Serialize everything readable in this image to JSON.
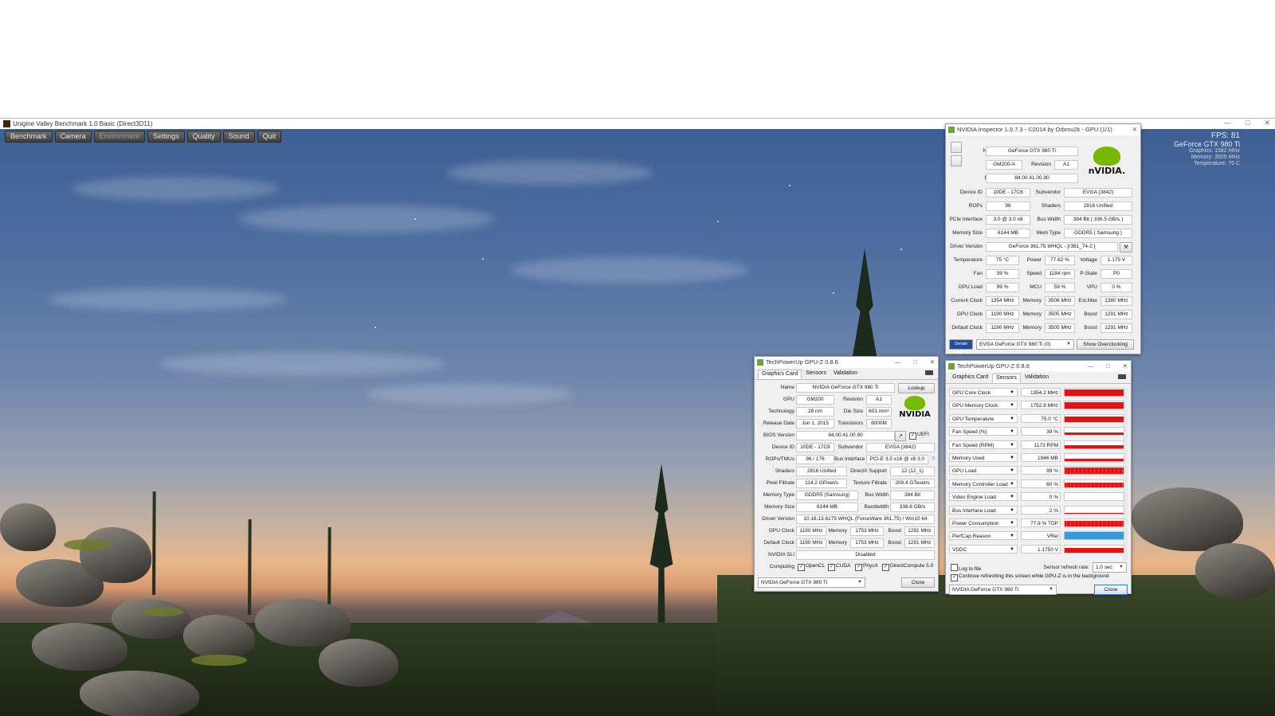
{
  "window": {
    "title": "Unigine Valley Benchmark 1.0 Basic (Direct3D11)",
    "controls": [
      "—",
      "□",
      "✕"
    ]
  },
  "menu": {
    "items": [
      {
        "label": "Benchmark",
        "enabled": true
      },
      {
        "label": "Camera",
        "enabled": true
      },
      {
        "label": "Environment",
        "enabled": false
      },
      {
        "label": "Settings",
        "enabled": true
      },
      {
        "label": "Quality",
        "enabled": true
      },
      {
        "label": "Sound",
        "enabled": true
      },
      {
        "label": "Quit",
        "enabled": true
      }
    ]
  },
  "overlay": {
    "fps": "FPS: 81",
    "gpu": "GeForce GTX 980 Ti",
    "graphics": "Graphics: 1582 MHz",
    "memory": "Memory: 3505 MHz",
    "temperature": "Temperature: 75 C"
  },
  "inspector": {
    "title": "NVIDIA Inspector 1.9.7.3 - ©2014 by Orbmu2k - GPU (1/1)",
    "name_label": "Name",
    "name": "GeForce GTX 980 Ti",
    "gpu_label": "GPU",
    "gpu": "GM200-A",
    "revision_label": "Revision",
    "revision": "A1",
    "bios_label": "BIOS",
    "bios": "84.00.41.00.90",
    "device_id_label": "Device ID",
    "device_id": "10DE - 17C8",
    "subvendor_label": "Subvendor",
    "subvendor": "EVGA (3842)",
    "rops_label": "ROPs",
    "rops": "96",
    "shaders_label": "Shaders",
    "shaders": "2816 Unified",
    "pcie_label": "PCIe Interface",
    "pcie": "3.0 @ 3.0 x8",
    "bus_width_label": "Bus Width",
    "bus_width": "384 Bit ( 336.5 GB/s )",
    "memory_size_label": "Memory Size",
    "memory_size": "6144 MB",
    "mem_type_label": "Mem Type",
    "mem_type": "GDDR5 ( Samsung )",
    "driver_label": "Driver Version",
    "driver": "GeForce 361.75 WHQL - [r361_74-2 ]",
    "temperature_label": "Temperature",
    "temperature": "75 °C",
    "power_label": "Power",
    "power": "77.62 %",
    "voltage_label": "Voltage",
    "voltage": "1.175 V",
    "fan_label": "Fan",
    "fan": "39 %",
    "speed_label": "Speed",
    "speed": "1184 rpm",
    "pstate_label": "P-State",
    "pstate": "P0",
    "gpu_load_label": "GPU Load",
    "gpu_load": "99 %",
    "mcu_label": "MCU",
    "mcu": "59 %",
    "vpu_label": "VPU",
    "vpu": "0 %",
    "current_clock_label": "Current Clock",
    "current_clock": "1354 MHz",
    "cur_mem_label": "Memory",
    "cur_mem": "3506 MHz",
    "est_max_label": "Est.Max",
    "est_max": "1380 MHz",
    "gpu_clock_label": "GPU Clock",
    "gpu_clock": "1190 MHz",
    "gpu_mem_label": "Memory",
    "gpu_mem": "3505 MHz",
    "gpu_boost_label": "Boost",
    "gpu_boost": "1291 MHz",
    "default_clock_label": "Default Clock",
    "default_clock": "1190 MHz",
    "def_mem_label": "Memory",
    "def_mem": "3505 MHz",
    "def_boost_label": "Boost",
    "def_boost": "1291 MHz",
    "donate_label": "Donate PayPal",
    "gpu_select": "EVGA GeForce GTX 980 Ti (0)",
    "overclock_button": "Show Overclocking"
  },
  "gpuz_card": {
    "title": "TechPowerUp GPU-Z 0.8.6",
    "tabs": [
      "Graphics Card",
      "Sensors",
      "Validation"
    ],
    "name_label": "Name",
    "name": "NVIDIA GeForce GTX 980 Ti",
    "lookup_button": "Lookup",
    "gpu_label": "GPU",
    "gpu": "GM200",
    "revision_label": "Revision",
    "revision": "A1",
    "technology_label": "Technology",
    "technology": "28 nm",
    "die_size_label": "Die Size",
    "die_size": "601 mm²",
    "release_label": "Release Date",
    "release": "Jun 1, 2015",
    "transistors_label": "Transistors",
    "transistors": "8000M",
    "bios_label": "BIOS Version",
    "bios": "84.00.41.00.90",
    "uefi_label": "UEFI",
    "device_id_label": "Device ID",
    "device_id": "10DE - 17C8",
    "subvendor_label": "Subvendor",
    "subvendor": "EVGA (3842)",
    "rops_label": "ROPs/TMUs",
    "rops": "96 / 176",
    "bus_label": "Bus Interface",
    "bus": "PCI-E 3.0 x16 @ x8 3.0",
    "help": "?",
    "shaders_label": "Shaders",
    "shaders": "2816 Unified",
    "directx_label": "DirectX Support",
    "directx": "12 (12_1)",
    "pixel_label": "Pixel Fillrate",
    "pixel": "114.2 GPixel/s",
    "texture_label": "Texture Fillrate",
    "texture": "209.4 GTexel/s",
    "memtype_label": "Memory Type",
    "memtype": "GDDR5 (Samsung)",
    "buswidth_label": "Bus Width",
    "buswidth": "384 Bit",
    "memsize_label": "Memory Size",
    "memsize": "6144 MB",
    "bandwidth_label": "Bandwidth",
    "bandwidth": "336.6 GB/s",
    "driver_label": "Driver Version",
    "driver": "10.18.13.6175 WHQL (ForceWare 361.75) / Win10 64",
    "gpuclock_label": "GPU Clock",
    "gpuclock": "1190 MHz",
    "mem1_label": "Memory",
    "mem1": "1753 MHz",
    "boost1_label": "Boost",
    "boost1": "1291 MHz",
    "defclock_label": "Default Clock",
    "defclock": "1190 MHz",
    "mem2_label": "Memory",
    "mem2": "1753 MHz",
    "boost2_label": "Boost",
    "boost2": "1291 MHz",
    "sli_label": "NVIDIA SLI",
    "sli": "Disabled",
    "computing_label": "Computing",
    "computing": [
      "OpenCL",
      "CUDA",
      "PhysX",
      "DirectCompute 5.0"
    ],
    "gpu_select": "NVIDIA GeForce GTX 980 Ti",
    "close_button": "Close"
  },
  "gpuz_sensors": {
    "title": "TechPowerUp GPU-Z 0.8.6",
    "tabs": [
      "Graphics Card",
      "Sensors",
      "Validation"
    ],
    "sensors": [
      {
        "name": "GPU Core Clock",
        "value": "1354.2 MHz",
        "level": 0.9,
        "color": "#e81010",
        "style": "solid"
      },
      {
        "name": "GPU Memory Clock",
        "value": "1752.8 MHz",
        "level": 0.9,
        "color": "#e81010",
        "style": "solid"
      },
      {
        "name": "GPU Temperature",
        "value": "75.0 °C",
        "level": 0.75,
        "color": "#e81010",
        "style": "solid"
      },
      {
        "name": "Fan Speed (%)",
        "value": "39 %",
        "level": 0.4,
        "color": "#e81010",
        "style": "solid"
      },
      {
        "name": "Fan Speed (RPM)",
        "value": "1173 RPM",
        "level": 0.4,
        "color": "#e81010",
        "style": "solid"
      },
      {
        "name": "Memory Used",
        "value": "1946 MB",
        "level": 0.3,
        "color": "#e81010",
        "style": "solid"
      },
      {
        "name": "GPU Load",
        "value": "99 %",
        "level": 0.95,
        "color": "#e81010",
        "style": "noisy"
      },
      {
        "name": "Memory Controller Load",
        "value": "60 %",
        "level": 0.6,
        "color": "#e81010",
        "style": "noisy"
      },
      {
        "name": "Video Engine Load",
        "value": "0 %",
        "level": 0,
        "color": "#e81010",
        "style": "solid"
      },
      {
        "name": "Bus Interface Load",
        "value": "2 %",
        "level": 0.05,
        "color": "#e81010",
        "style": "solid"
      },
      {
        "name": "Power Consumption",
        "value": "77.8 % TDP",
        "level": 0.78,
        "color": "#e81010",
        "style": "noisy"
      },
      {
        "name": "PerfCap Reason",
        "value": "VRel",
        "level": 1,
        "color": "#3a9ad9",
        "style": "solid"
      },
      {
        "name": "VDDC",
        "value": "1.1750 V",
        "level": 0.6,
        "color": "#e81010",
        "style": "solid"
      }
    ],
    "log_label": "Log to file",
    "refresh_label": "Sensor refresh rate:",
    "refresh_value": "1.0 sec",
    "continue_label": "Continue refreshing this screen while GPU-Z is in the background",
    "gpu_select": "NVIDIA GeForce GTX 980 Ti",
    "close_button": "Close"
  }
}
